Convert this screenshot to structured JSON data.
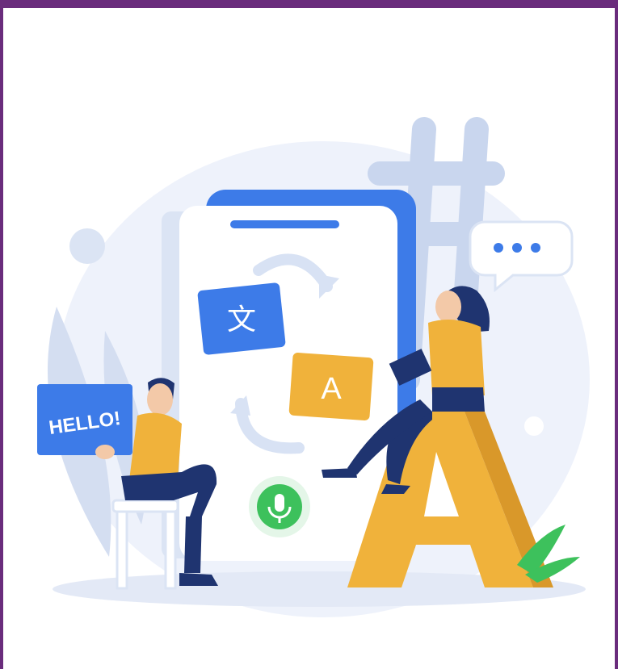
{
  "illustration": {
    "hello_card_text": "HELLO!",
    "source_card_glyph": "文",
    "target_card_glyph": "A",
    "big_letter": "A",
    "colors": {
      "frame": "#6a2c7c",
      "primary_blue": "#3d7be8",
      "yellow": "#f0b23b",
      "navy": "#1f3470",
      "light_blue": "#dde6f5",
      "green": "#3dc15c"
    }
  }
}
